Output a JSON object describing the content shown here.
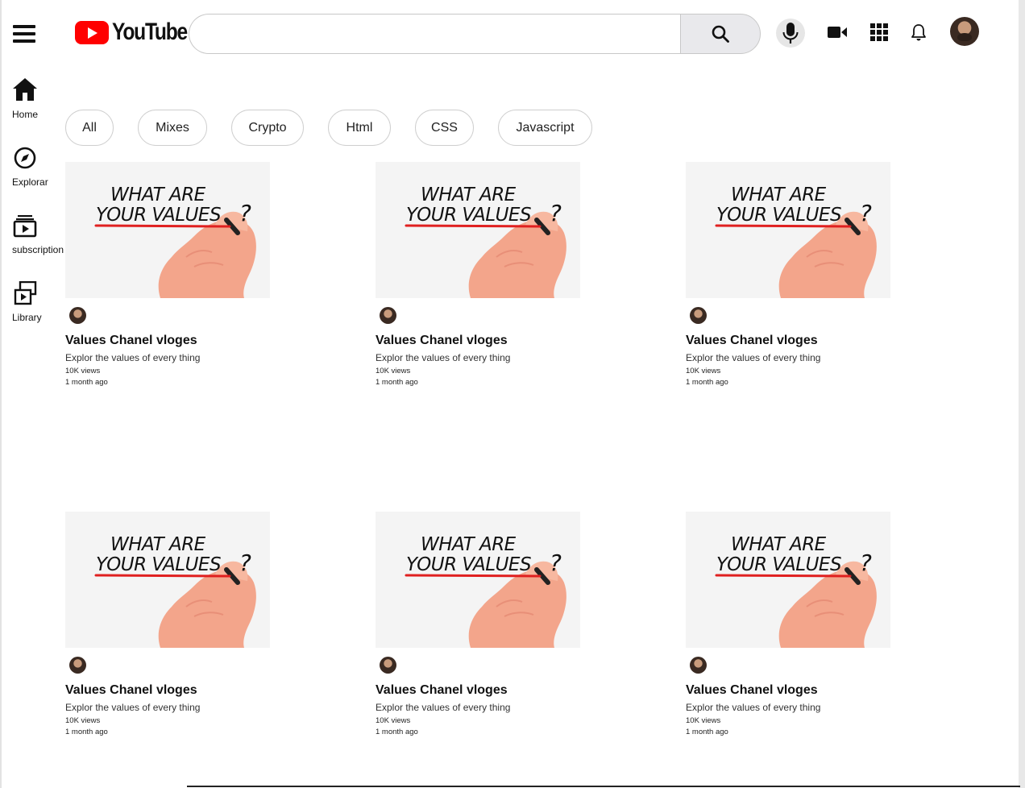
{
  "header": {
    "logo_text": "YouTube",
    "search_value": "",
    "search_placeholder": ""
  },
  "sidebar": {
    "items": [
      {
        "label": "Home"
      },
      {
        "label": "Explorar"
      },
      {
        "label": "subscription"
      },
      {
        "label": "Library"
      }
    ]
  },
  "chips": [
    {
      "label": "All"
    },
    {
      "label": "Mixes"
    },
    {
      "label": "Crypto"
    },
    {
      "label": "Html"
    },
    {
      "label": "CSS"
    },
    {
      "label": "Javascript"
    }
  ],
  "videos": [
    {
      "thumb_line1": "WHAT ARE",
      "thumb_line2": "YOUR VALUES",
      "thumb_mark": "?",
      "title": "Values Chanel vloges",
      "description": "Explor the values of every thing",
      "views": "10K views",
      "age": "1 month ago"
    },
    {
      "thumb_line1": "WHAT ARE",
      "thumb_line2": "YOUR VALUES",
      "thumb_mark": "?",
      "title": "Values Chanel vloges",
      "description": "Explor the values of every thing",
      "views": "10K views",
      "age": "1 month ago"
    },
    {
      "thumb_line1": "WHAT ARE",
      "thumb_line2": "YOUR VALUES",
      "thumb_mark": "?",
      "title": "Values Chanel vloges",
      "description": "Explor the values of every thing",
      "views": "10K views",
      "age": "1 month ago"
    },
    {
      "thumb_line1": "WHAT ARE",
      "thumb_line2": "YOUR VALUES",
      "thumb_mark": "?",
      "title": "Values Chanel vloges",
      "description": "Explor the values of every thing",
      "views": "10K views",
      "age": "1 month ago"
    },
    {
      "thumb_line1": "WHAT ARE",
      "thumb_line2": "YOUR VALUES",
      "thumb_mark": "?",
      "title": "Values Chanel vloges",
      "description": "Explor the values of every thing",
      "views": "10K views",
      "age": "1 month ago"
    },
    {
      "thumb_line1": "WHAT ARE",
      "thumb_line2": "YOUR VALUES",
      "thumb_mark": "?",
      "title": "Values Chanel vloges",
      "description": "Explor the values of every thing",
      "views": "10K views",
      "age": "1 month ago"
    }
  ],
  "icons": {
    "menu": "menu-icon",
    "search": "search-icon",
    "mic": "microphone-icon",
    "create": "video-camera-icon",
    "apps": "apps-grid-icon",
    "notifications": "bell-icon",
    "home": "home-icon",
    "explore": "compass-icon",
    "subscriptions": "subscriptions-icon",
    "library": "library-icon"
  },
  "colors": {
    "brand_red": "#ff0000",
    "underline_red": "#e02020",
    "search_button_bg": "#e9e9ec"
  }
}
